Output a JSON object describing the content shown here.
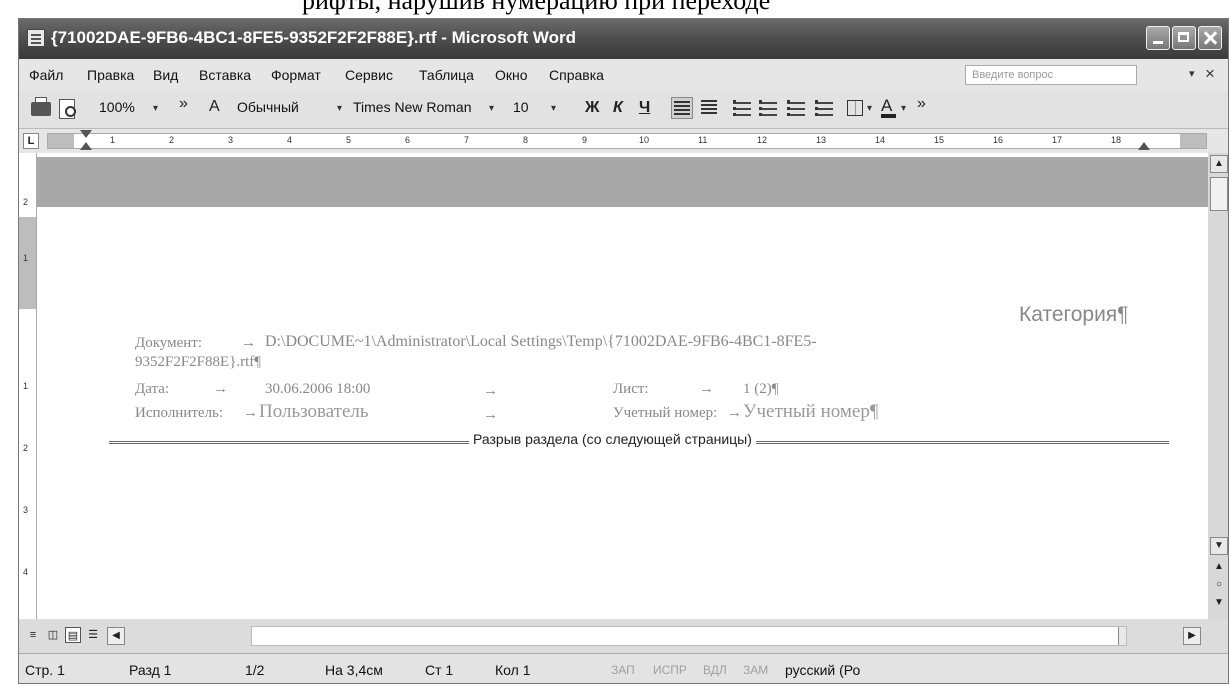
{
  "caption_fragment": "рифты, нарушив нумерацию при переходе",
  "window": {
    "title": "{71002DAE-9FB6-4BC1-8FE5-9352F2F2F88E}.rtf - Microsoft Word"
  },
  "menu": {
    "items": [
      "Файл",
      "Правка",
      "Вид",
      "Вставка",
      "Формат",
      "Сервис",
      "Таблица",
      "Окно",
      "Справка"
    ],
    "help_placeholder": "Введите вопрос",
    "help_close": "×"
  },
  "toolbar": {
    "zoom": "100%",
    "style": "Обычный",
    "font": "Times New Roman",
    "size": "10",
    "bold": "Ж",
    "italic": "К",
    "underline": "Ч",
    "more": "»",
    "dropdown": "▾"
  },
  "ruler": {
    "tab_selector": "L",
    "ticks": [
      "1",
      "2",
      "3",
      "4",
      "5",
      "6",
      "7",
      "8",
      "9",
      "10",
      "11",
      "12",
      "13",
      "14",
      "15",
      "16",
      "17",
      "18"
    ],
    "vticks": [
      "2",
      "1",
      "1",
      "2",
      "3",
      "4"
    ]
  },
  "document": {
    "category": "Категория¶",
    "doc_label": "Документ:",
    "doc_path_1": "D:\\DOCUME~1\\Administrator\\Local Settings\\Temp\\{71002DAE-9FB6-4BC1-8FE5-",
    "doc_path_2": "9352F2F2F88E}.rtf¶",
    "date_label": "Дата:",
    "date_value": "30.06.2006 18:00",
    "sheet_label": "Лист:",
    "sheet_value": "1 (2)¶",
    "executor_label": "Исполнитель:",
    "executor_value": "Пользователь",
    "account_label": "Учетный номер:",
    "account_value": "Учетный номер¶",
    "arrow": "→",
    "section_break": "Разрыв раздела (со следующей страницы)"
  },
  "statusbar": {
    "page": "Стр. 1",
    "section": "Разд 1",
    "pages": "1/2",
    "at": "На 3,4см",
    "line": "Ст 1",
    "col": "Кол 1",
    "rec": "ЗАП",
    "trk": "ИСПР",
    "ext": "ВДЛ",
    "ovr": "ЗАМ",
    "lang": "русский (Ро"
  }
}
